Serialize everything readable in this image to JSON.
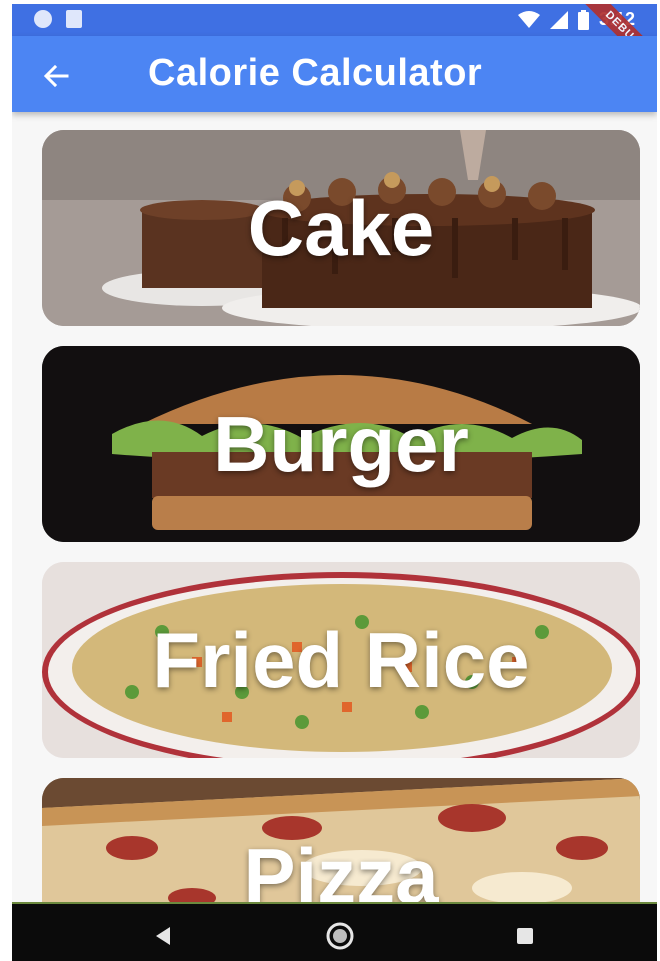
{
  "status_bar": {
    "time": "3:12",
    "debug_banner": "DEBUG"
  },
  "app_bar": {
    "title": "Calorie Calculator",
    "back_icon": "arrow-left-icon"
  },
  "foods": [
    {
      "label": "Cake"
    },
    {
      "label": "Burger"
    },
    {
      "label": "Fried Rice"
    },
    {
      "label": "Pizza"
    }
  ],
  "nav_bar": {
    "back_icon": "triangle-back-icon",
    "home_icon": "circle-home-icon",
    "recents_icon": "square-recents-icon"
  },
  "colors": {
    "status_bar": "#3f70e3",
    "app_bar": "#4c85f3",
    "nav_bar": "#0b0b0b"
  }
}
